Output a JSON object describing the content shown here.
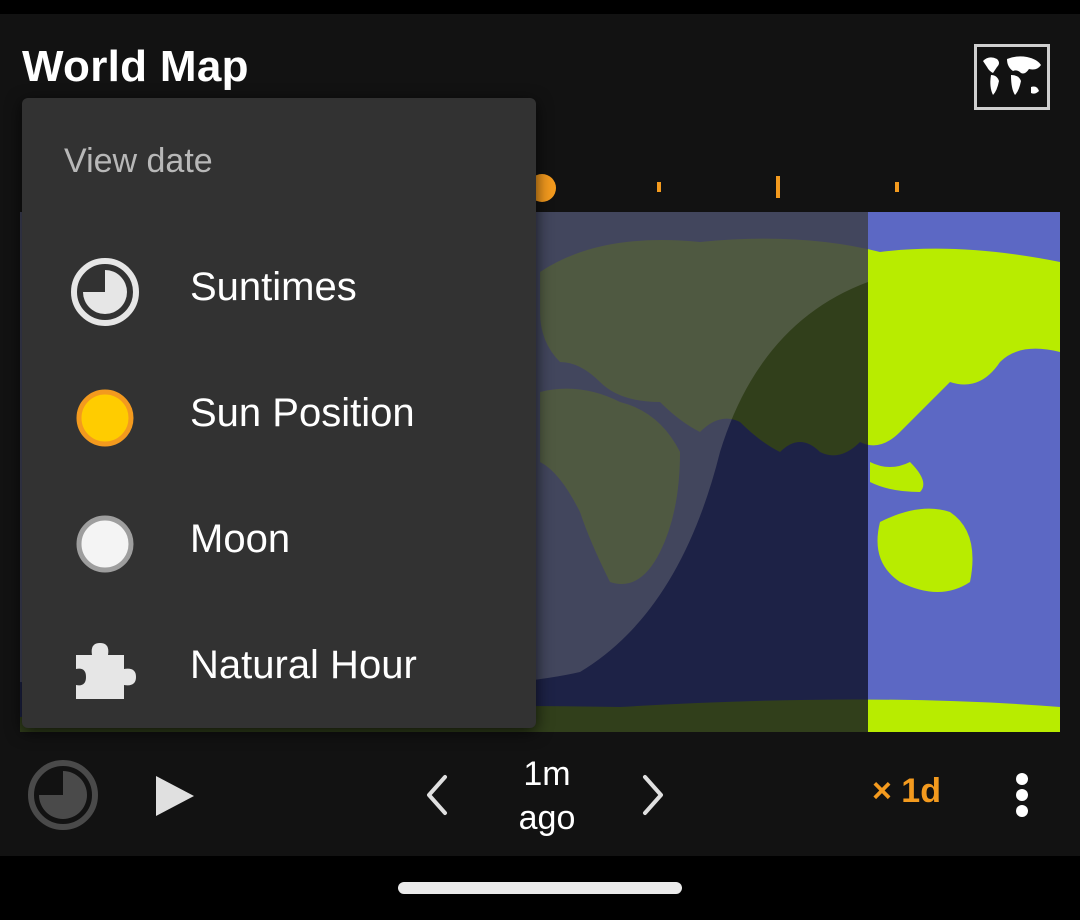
{
  "dialog": {
    "title": "World Map",
    "map_mode_icon": "world-map-icon"
  },
  "colors": {
    "accent": "#f39a1e",
    "land_day": "#b8ec00",
    "ocean_day": "#5c68c4",
    "menu_bg": "#323232",
    "sun_fill": "#ffcc00"
  },
  "menu": {
    "header": "View date",
    "items": [
      {
        "label": "Suntimes",
        "icon": "suntimes-clock-icon"
      },
      {
        "label": "Sun Position",
        "icon": "sun-icon"
      },
      {
        "label": "Moon",
        "icon": "moon-icon"
      },
      {
        "label": "Natural Hour",
        "icon": "puzzle-piece-icon"
      }
    ]
  },
  "controls": {
    "reset_icon": "suntimes-clock-icon",
    "play_icon": "play-icon",
    "prev_icon": "chevron-left-icon",
    "next_icon": "chevron-right-icon",
    "offset_line1": "1m",
    "offset_line2": "ago",
    "speed": "× 1d",
    "overflow_icon": "more-vert-icon"
  }
}
